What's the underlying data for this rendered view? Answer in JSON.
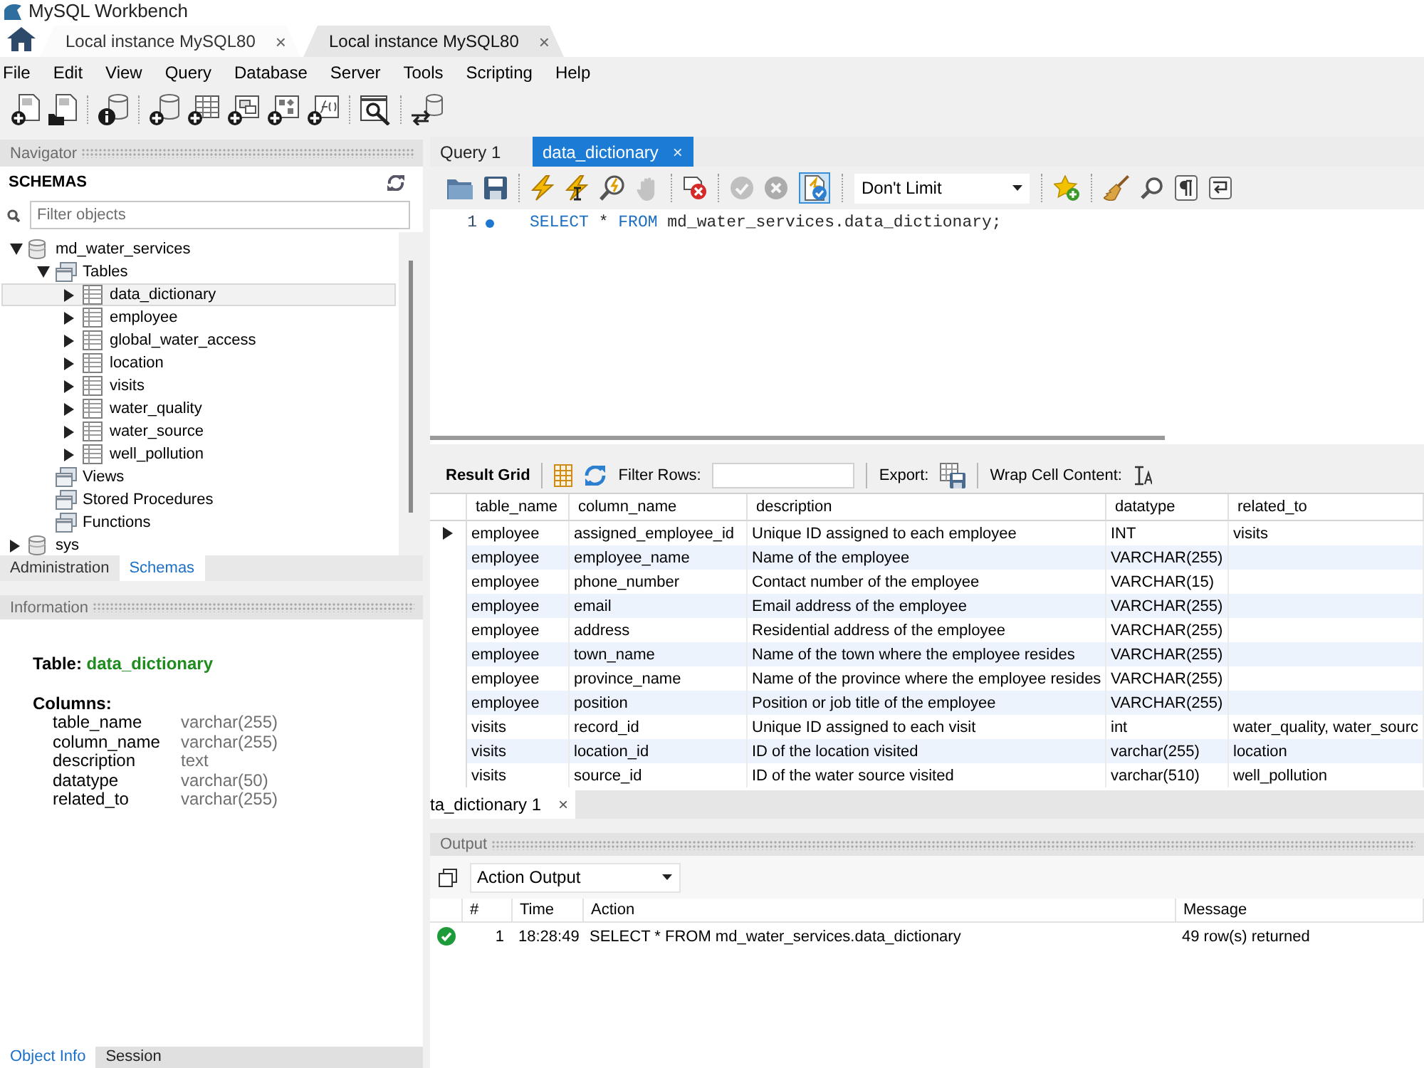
{
  "window": {
    "title": "MySQL Workbench"
  },
  "connection_tabs": [
    {
      "label": "Local instance MySQL80",
      "close": "×",
      "selected": false
    },
    {
      "label": "Local instance MySQL80",
      "close": "×",
      "selected": true
    }
  ],
  "menu": [
    "File",
    "Edit",
    "View",
    "Query",
    "Database",
    "Server",
    "Tools",
    "Scripting",
    "Help"
  ],
  "navigator": {
    "title": "Navigator",
    "heading": "SCHEMAS",
    "filter": {
      "placeholder": "Filter objects"
    },
    "tree": [
      {
        "label": "md_water_services",
        "kind": "schema",
        "expanded": true,
        "selected": false,
        "children": [
          {
            "label": "Tables",
            "kind": "folder",
            "expanded": true,
            "selected": false,
            "children": [
              {
                "label": "data_dictionary",
                "kind": "table",
                "expanded": false,
                "selected": true
              },
              {
                "label": "employee",
                "kind": "table",
                "expanded": false,
                "selected": false
              },
              {
                "label": "global_water_access",
                "kind": "table",
                "expanded": false,
                "selected": false
              },
              {
                "label": "location",
                "kind": "table",
                "expanded": false,
                "selected": false
              },
              {
                "label": "visits",
                "kind": "table",
                "expanded": false,
                "selected": false
              },
              {
                "label": "water_quality",
                "kind": "table",
                "expanded": false,
                "selected": false
              },
              {
                "label": "water_source",
                "kind": "table",
                "expanded": false,
                "selected": false
              },
              {
                "label": "well_pollution",
                "kind": "table",
                "expanded": false,
                "selected": false
              }
            ]
          },
          {
            "label": "Views",
            "kind": "folder",
            "selected": false
          },
          {
            "label": "Stored Procedures",
            "kind": "folder",
            "selected": false
          },
          {
            "label": "Functions",
            "kind": "folder",
            "selected": false
          }
        ]
      },
      {
        "label": "sys",
        "kind": "schema",
        "expanded": false,
        "selected": false
      }
    ],
    "tabs": [
      {
        "label": "Administration",
        "selected": false
      },
      {
        "label": "Schemas",
        "selected": true
      }
    ]
  },
  "information": {
    "title": "Information",
    "table_label": "Table:",
    "table_name": "data_dictionary",
    "columns_label": "Columns:",
    "columns": [
      {
        "name": "table_name",
        "type": "varchar(255)"
      },
      {
        "name": "column_name",
        "type": "varchar(255)"
      },
      {
        "name": "description",
        "type": "text"
      },
      {
        "name": "datatype",
        "type": "varchar(50)"
      },
      {
        "name": "related_to",
        "type": "varchar(255)"
      }
    ],
    "tabs": [
      {
        "label": "Object Info",
        "selected": true
      },
      {
        "label": "Session",
        "selected": false
      }
    ]
  },
  "editor": {
    "tabs": [
      {
        "label": "Query 1",
        "selected": false
      },
      {
        "label": "data_dictionary",
        "close": "×",
        "selected": true
      }
    ],
    "stop": {
      "disabled": true
    },
    "commit": {
      "disabled": true
    },
    "rollback": {
      "disabled": true
    },
    "autocommit": {
      "on": true
    },
    "limit": "Don't Limit",
    "lines": [
      {
        "number": "1",
        "tokens": [
          {
            "text": "SELECT",
            "kind": "keyword"
          },
          {
            "text": "*",
            "kind": "plain"
          },
          {
            "text": "FROM",
            "kind": "keyword"
          },
          {
            "text": "md_water_services.data_dictionary;",
            "kind": "plain"
          }
        ]
      }
    ]
  },
  "results": {
    "toolbar": {
      "view": "Result Grid",
      "filter_label": "Filter Rows:",
      "export_label": "Export:",
      "wrap_label": "Wrap Cell Content:"
    },
    "columns": [
      "table_name",
      "column_name",
      "description",
      "datatype",
      "related_to"
    ],
    "rows": [
      {
        "cells": [
          "employee",
          "assigned_employee_id",
          "Unique ID assigned to each employee",
          "INT",
          "visits"
        ],
        "selected": true
      },
      {
        "cells": [
          "employee",
          "employee_name",
          "Name of the employee",
          "VARCHAR(255)"
        ],
        "selected": false
      },
      {
        "cells": [
          "employee",
          "phone_number",
          "Contact number of the employee",
          "VARCHAR(15)"
        ],
        "selected": false
      },
      {
        "cells": [
          "employee",
          "email",
          "Email address of the employee",
          "VARCHAR(255)"
        ],
        "selected": false
      },
      {
        "cells": [
          "employee",
          "address",
          "Residential address of the employee",
          "VARCHAR(255)"
        ],
        "selected": false
      },
      {
        "cells": [
          "employee",
          "town_name",
          "Name of the town where the employee resides",
          "VARCHAR(255)"
        ],
        "selected": false
      },
      {
        "cells": [
          "employee",
          "province_name",
          "Name of the province where the employee resides",
          "VARCHAR(255)"
        ],
        "selected": false
      },
      {
        "cells": [
          "employee",
          "position",
          "Position or job title of the employee",
          "VARCHAR(255)"
        ],
        "selected": false
      },
      {
        "cells": [
          "visits",
          "record_id",
          "Unique ID assigned to each visit",
          "int",
          "water_quality, water_sourc"
        ],
        "selected": false
      },
      {
        "cells": [
          "visits",
          "location_id",
          "ID of the location visited",
          "varchar(255)",
          "location"
        ],
        "selected": false
      },
      {
        "cells": [
          "visits",
          "source_id",
          "ID of the water source visited",
          "varchar(510)",
          "well_pollution"
        ],
        "selected": false
      }
    ],
    "tab": {
      "label": "ta_dictionary 1",
      "close": "×",
      "selected": true
    }
  },
  "output": {
    "title": "Output",
    "view": "Action Output",
    "columns": [
      "#",
      "Time",
      "Action",
      "Message"
    ],
    "rows": [
      {
        "kind": "success",
        "number": "1",
        "time": "18:28:49",
        "action": "SELECT * FROM md_water_services.data_dictionary",
        "message": "49 row(s) returned"
      }
    ]
  }
}
